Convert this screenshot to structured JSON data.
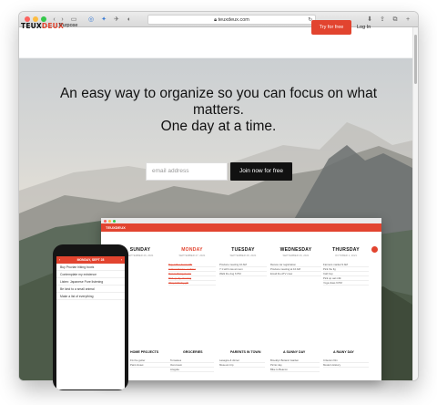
{
  "browser": {
    "address": "teuxdeux.com",
    "lock_icon": "lock-icon",
    "traffic_lights": [
      "#fc615d",
      "#fdbc40",
      "#34c84a"
    ]
  },
  "header": {
    "logo_part1": "TEUX",
    "logo_part2": "DEUX",
    "nav_purpose": "Purpose",
    "try_button": "Try for free",
    "login": "Log In",
    "accent": "#e2442f"
  },
  "hero": {
    "line1": "An easy way to organize so you can focus on what",
    "line2": "matters.",
    "line3": "One day at a time.",
    "email_placeholder": "email address",
    "join_button": "Join now for free"
  },
  "app_preview": {
    "logo": "TEUXDEUX",
    "days": [
      {
        "name": "SUNDAY",
        "date": "SEPTEMBER 26, 2021",
        "tasks": [
          "",
          "",
          "",
          "",
          ""
        ]
      },
      {
        "name": "MONDAY",
        "date": "SEPTEMBER 27, 2021",
        "tasks": [
          "Buy coffee beans 5lb",
          "Call landlord re: radiator",
          "Return library books",
          "Pick up dry cleaning",
          "Wrap birthday gift"
        ]
      },
      {
        "name": "TUESDAY",
        "date": "SEPTEMBER 28, 2021",
        "tasks": [
          "Produce meeting 10 AM",
          "7:1 with Lisa at noon",
          "Walk the dog 6 PM"
        ]
      },
      {
        "name": "WEDNESDAY",
        "date": "SEPTEMBER 29, 2021",
        "tasks": [
          "Renew car registration",
          "Produce meeting at 10 AM",
          "Email the ATV crew"
        ]
      },
      {
        "name": "THURSDAY",
        "date": "OCTOBER 1, 2021",
        "tasks": [
          "Farmers market 9 AM",
          "Pick the fig",
          "Call Cup",
          "Pick up oat milk",
          "Yoga class 6 PM"
        ]
      }
    ],
    "lists": [
      "HOME PROJECTS",
      "GROCERIES",
      "PARENTS IN TOWN",
      "A SUNNY DAY",
      "A RAINY DAY"
    ],
    "list_items": [
      [
        "Fix the gutter",
        "Paint closet",
        ""
      ],
      [
        "Tomatoes",
        "Oat cream",
        "Arugula"
      ],
      [
        "Lasagna & dinner",
        "Museum trip",
        ""
      ],
      [
        "Brooklyn Botanic Garden",
        "Picnic day",
        "Bike to Beacon"
      ],
      [
        "Criterion film",
        "Modern History",
        ""
      ]
    ]
  },
  "phone": {
    "header": "MONDAY, SEPT 28",
    "tasks": [
      "Buy Pruvian hiking boots",
      "Contemplate my existence",
      "Listen: Japanese Pure listening",
      "Be kind to a small animal",
      "Make a list of everything"
    ]
  }
}
